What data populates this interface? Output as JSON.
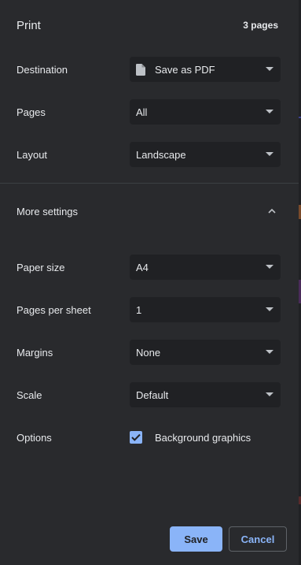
{
  "header": {
    "title": "Print",
    "page_count": "3 pages"
  },
  "destination": {
    "label": "Destination",
    "value": "Save as PDF",
    "icon": "file-icon"
  },
  "pages": {
    "label": "Pages",
    "value": "All"
  },
  "layout": {
    "label": "Layout",
    "value": "Landscape"
  },
  "more_settings": {
    "label": "More settings",
    "icon": "chevron-up-icon"
  },
  "paper_size": {
    "label": "Paper size",
    "value": "A4"
  },
  "pages_per_sheet": {
    "label": "Pages per sheet",
    "value": "1"
  },
  "margins": {
    "label": "Margins",
    "value": "None"
  },
  "scale": {
    "label": "Scale",
    "value": "Default"
  },
  "options": {
    "label": "Options",
    "background_graphics_label": "Background graphics",
    "background_graphics_checked": true
  },
  "actions": {
    "save_label": "Save",
    "cancel_label": "Cancel"
  },
  "colors": {
    "background": "#292a2d",
    "field": "#202124",
    "accent": "#8ab4f8",
    "text": "#e8eaed"
  }
}
